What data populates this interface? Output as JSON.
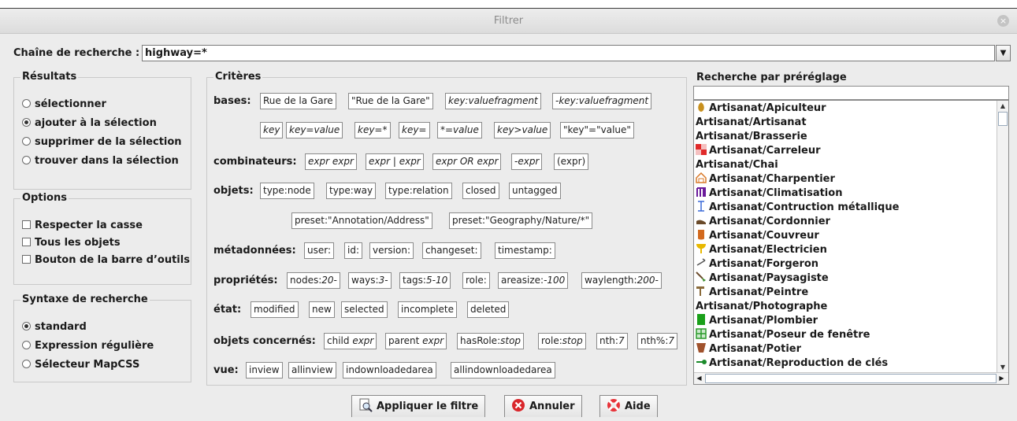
{
  "window": {
    "title": "Filtrer",
    "close_glyph": "×"
  },
  "search": {
    "label": "Chaîne de recherche :",
    "value": "highway=*",
    "dropdown_icon": "chevron-down-icon"
  },
  "results": {
    "title": "Résultats",
    "options": [
      "sélectionner",
      "ajouter à la sélection",
      "supprimer de la sélection",
      "trouver dans la sélection"
    ],
    "selected_index": 1
  },
  "options": {
    "title": "Options",
    "checkboxes": [
      "Respecter la casse",
      "Tous les objets",
      "Bouton de la barre d’outils"
    ]
  },
  "syntax": {
    "title": "Syntaxe de recherche",
    "options": [
      "standard",
      "Expression régulière",
      "Sélecteur MapCSS"
    ],
    "selected_index": 0
  },
  "criteria": {
    "title": "Critères",
    "labels": {
      "bases": "bases:",
      "combinators": "combinateurs:",
      "objects": "objets:",
      "metadata": "métadonnées:",
      "properties": "propriétés:",
      "state": "état:",
      "related": "objets concernés:",
      "view": "vue:"
    },
    "bases_row1": [
      "Rue de la Gare",
      "\"Rue de la Gare\"",
      "key:valuefragment",
      "-key:valuefragment"
    ],
    "bases_row2": [
      "key",
      "key=value",
      "key=*",
      "key=",
      "*=value",
      "key>value",
      "\"key\"=\"value\""
    ],
    "combinators": [
      "expr expr",
      "expr | expr",
      "expr OR expr",
      "-expr",
      "(expr)"
    ],
    "objects_row1": [
      "type:node",
      "type:way",
      "type:relation",
      "closed",
      "untagged"
    ],
    "objects_row2": [
      "preset:\"Annotation/Address\"",
      "preset:\"Geography/Nature/*\""
    ],
    "metadata": [
      "user:",
      "id:",
      "version:",
      "changeset:",
      "timestamp:"
    ],
    "properties": [
      {
        "key": "nodes:",
        "val": "20-"
      },
      {
        "key": "ways:",
        "val": "3-"
      },
      {
        "key": "tags:",
        "val": "5-10"
      },
      {
        "key": "role:",
        "val": ""
      },
      {
        "key": "areasize:",
        "val": "-100"
      },
      {
        "key": "waylength:",
        "val": "200-"
      }
    ],
    "state": [
      "modified",
      "new",
      "selected",
      "incomplete",
      "deleted"
    ],
    "related": [
      {
        "key": "child ",
        "val": "expr"
      },
      {
        "key": "parent ",
        "val": "expr"
      },
      {
        "key": "hasRole:",
        "val": "stop"
      },
      {
        "key": "role:",
        "val": "stop"
      },
      {
        "key": "nth:",
        "val": "7"
      },
      {
        "key": "nth%:",
        "val": "7"
      }
    ],
    "view": [
      "inview",
      "allinview",
      "indownloadedarea",
      "allindownloadedarea"
    ]
  },
  "presets": {
    "title": "Recherche par préréglage",
    "search_value": "",
    "items": [
      {
        "label": "Artisanat/Apiculteur",
        "icon": "beehive-icon",
        "color": "#c8901e"
      },
      {
        "label": "Artisanat/Artisanat",
        "icon": "",
        "color": ""
      },
      {
        "label": "Artisanat/Brasserie",
        "icon": "",
        "color": ""
      },
      {
        "label": "Artisanat/Carreleur",
        "icon": "tiles-icon",
        "color": "#e02a2a"
      },
      {
        "label": "Artisanat/Chai",
        "icon": "",
        "color": ""
      },
      {
        "label": "Artisanat/Charpentier",
        "icon": "house-frame-icon",
        "color": "#d97a2a"
      },
      {
        "label": "Artisanat/Climatisation",
        "icon": "radiator-icon",
        "color": "#6a1a9a"
      },
      {
        "label": "Artisanat/Contruction métallique",
        "icon": "i-beam-icon",
        "color": "#3a6ad8"
      },
      {
        "label": "Artisanat/Cordonnier",
        "icon": "shoe-icon",
        "color": "#6a4a2a"
      },
      {
        "label": "Artisanat/Couvreur",
        "icon": "roof-icon",
        "color": "#d2691e"
      },
      {
        "label": "Artisanat/Electricien",
        "icon": "bulb-icon",
        "color": "#e8b800"
      },
      {
        "label": "Artisanat/Forgeron",
        "icon": "anvil-icon",
        "color": "#555555"
      },
      {
        "label": "Artisanat/Paysagiste",
        "icon": "shovel-icon",
        "color": "#3a8a2a"
      },
      {
        "label": "Artisanat/Peintre",
        "icon": "paint-roller-icon",
        "color": "#8a6a3a"
      },
      {
        "label": "Artisanat/Photographe",
        "icon": "",
        "color": ""
      },
      {
        "label": "Artisanat/Plombier",
        "icon": "pipe-icon",
        "color": "#1aa01a"
      },
      {
        "label": "Artisanat/Poseur de fenêtre",
        "icon": "window-icon",
        "color": "#2a9a2a"
      },
      {
        "label": "Artisanat/Potier",
        "icon": "pot-icon",
        "color": "#a0522d"
      },
      {
        "label": "Artisanat/Reproduction de clés",
        "icon": "key-icon",
        "color": "#1a8a2a"
      }
    ]
  },
  "buttons": {
    "apply": {
      "label": "Appliquer le filtre",
      "icon": "magnifier-icon"
    },
    "cancel": {
      "label": "Annuler",
      "icon": "cancel-icon"
    },
    "help": {
      "label": "Aide",
      "icon": "lifebuoy-icon"
    }
  }
}
